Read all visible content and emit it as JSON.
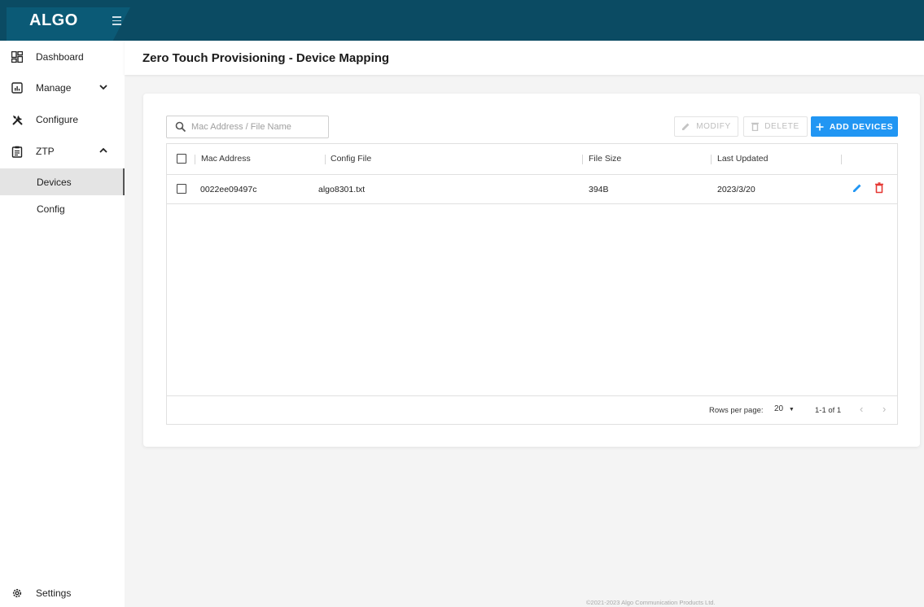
{
  "app": {
    "logo": "ALGO"
  },
  "sidebar": {
    "items": [
      {
        "label": "Dashboard",
        "icon": "dashboard-icon"
      },
      {
        "label": "Manage",
        "icon": "manage-icon"
      },
      {
        "label": "Configure",
        "icon": "tools-icon"
      },
      {
        "label": "ZTP",
        "icon": "clipboard-icon"
      }
    ],
    "ztp_sub": [
      {
        "label": "Devices",
        "active": true
      },
      {
        "label": "Config",
        "active": false
      }
    ],
    "settings": {
      "label": "Settings",
      "icon": "gear-icon"
    }
  },
  "header": {
    "title": "Zero Touch Provisioning - Device Mapping"
  },
  "toolbar": {
    "search_placeholder": "Mac Address / File Name",
    "modify_label": "MODIFY",
    "delete_label": "DELETE",
    "add_label": "ADD DEVICES"
  },
  "table": {
    "columns": [
      "Mac Address",
      "Config File",
      "File Size",
      "Last Updated"
    ],
    "rows": [
      {
        "mac": "0022ee09497c",
        "config_file": "algo8301.txt",
        "file_size": "394B",
        "last_updated": "2023/3/20"
      }
    ]
  },
  "pagination": {
    "rows_per_page_label": "Rows per page:",
    "rows_per_page_value": "20",
    "page_info": "1-1 of 1"
  },
  "footer": {
    "copyright": "©2021-2023 Algo Communication Products Ltd."
  },
  "colors": {
    "topbar": "#0b4b63",
    "primary": "#2196f3",
    "delete": "#e53935"
  }
}
